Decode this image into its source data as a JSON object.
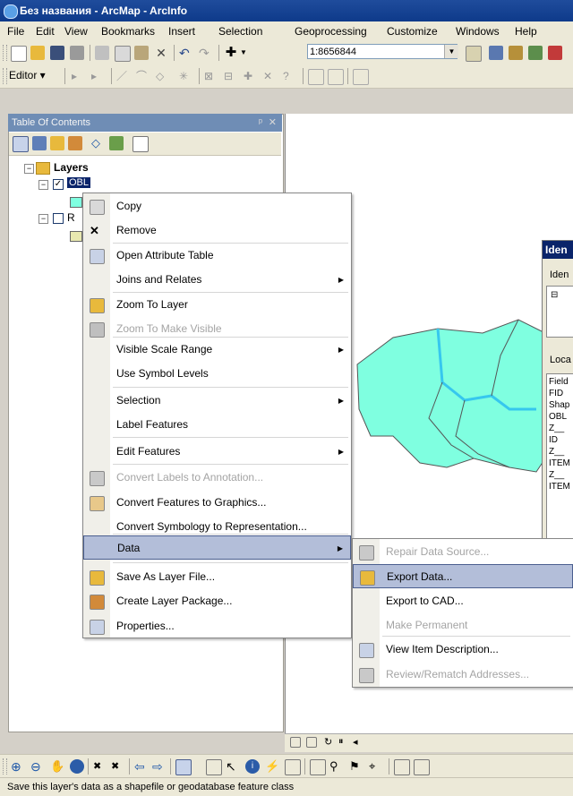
{
  "window": {
    "title": "Без названия - ArcMap - ArcInfo"
  },
  "menubar": [
    "File",
    "Edit",
    "View",
    "Bookmarks",
    "Insert",
    "Selection",
    "Geoprocessing",
    "Customize",
    "Windows",
    "Help"
  ],
  "standard_toolbar": {
    "scale": "1:8656844"
  },
  "editor_toolbar": {
    "editor_label": "Editor ▾"
  },
  "toc": {
    "header": "Table Of Contents",
    "root_label": "Layers",
    "layer1_label": "OBL",
    "layer2_label": "R"
  },
  "identify": {
    "title": "Iden",
    "identify_from": "Iden",
    "location": "Loca",
    "fields": [
      "Field",
      "FID",
      "Shap",
      "OBL",
      "Z__",
      "ID",
      "Z__",
      "ITEM",
      "Z__",
      "ITEM"
    ]
  },
  "context_menu": [
    {
      "label": "Copy",
      "icon": "copy-icon",
      "enabled": true
    },
    {
      "label": "Remove",
      "icon": "remove-icon",
      "enabled": true
    },
    {
      "label": "Open Attribute Table",
      "icon": "table-icon",
      "enabled": true
    },
    {
      "label": "Joins and Relates",
      "icon": "",
      "enabled": true,
      "submenu": true
    },
    {
      "label": "Zoom To Layer",
      "icon": "zoom-to-layer-icon",
      "enabled": true
    },
    {
      "label": "Zoom To Make Visible",
      "icon": "zoom-visible-icon",
      "enabled": false
    },
    {
      "label": "Visible Scale Range",
      "icon": "",
      "enabled": true,
      "submenu": true
    },
    {
      "label": "Use Symbol Levels",
      "icon": "",
      "enabled": true
    },
    {
      "label": "Selection",
      "icon": "",
      "enabled": true,
      "submenu": true
    },
    {
      "label": "Label Features",
      "icon": "",
      "enabled": true
    },
    {
      "label": "Edit Features",
      "icon": "",
      "enabled": true,
      "submenu": true
    },
    {
      "label": "Convert Labels to Annotation...",
      "icon": "convert-labels-icon",
      "enabled": false
    },
    {
      "label": "Convert Features to Graphics...",
      "icon": "convert-features-icon",
      "enabled": true
    },
    {
      "label": "Convert Symbology to Representation...",
      "icon": "",
      "enabled": true
    },
    {
      "label": "Data",
      "icon": "",
      "enabled": true,
      "submenu": true,
      "selected": true
    },
    {
      "label": "Save As Layer File...",
      "icon": "layer-file-icon",
      "enabled": true
    },
    {
      "label": "Create Layer Package...",
      "icon": "layer-package-icon",
      "enabled": true
    },
    {
      "label": "Properties...",
      "icon": "properties-icon",
      "enabled": true
    }
  ],
  "data_submenu": [
    {
      "label": "Repair Data Source...",
      "icon": "repair-icon",
      "enabled": false
    },
    {
      "label": "Export Data...",
      "icon": "export-data-icon",
      "enabled": true,
      "selected": true
    },
    {
      "label": "Export to CAD...",
      "icon": "",
      "enabled": true
    },
    {
      "label": "Make Permanent",
      "icon": "",
      "enabled": false
    },
    {
      "label": "View Item Description...",
      "icon": "item-description-icon",
      "enabled": true
    },
    {
      "label": "Review/Rematch Addresses...",
      "icon": "review-icon",
      "enabled": false
    }
  ],
  "status": "Save this layer's data as a shapefile or geodatabase feature class",
  "colors": {
    "polygon_fill": "#7fffe0",
    "highlight": "#b3bed9",
    "title_bar": "#0e3a8a"
  }
}
